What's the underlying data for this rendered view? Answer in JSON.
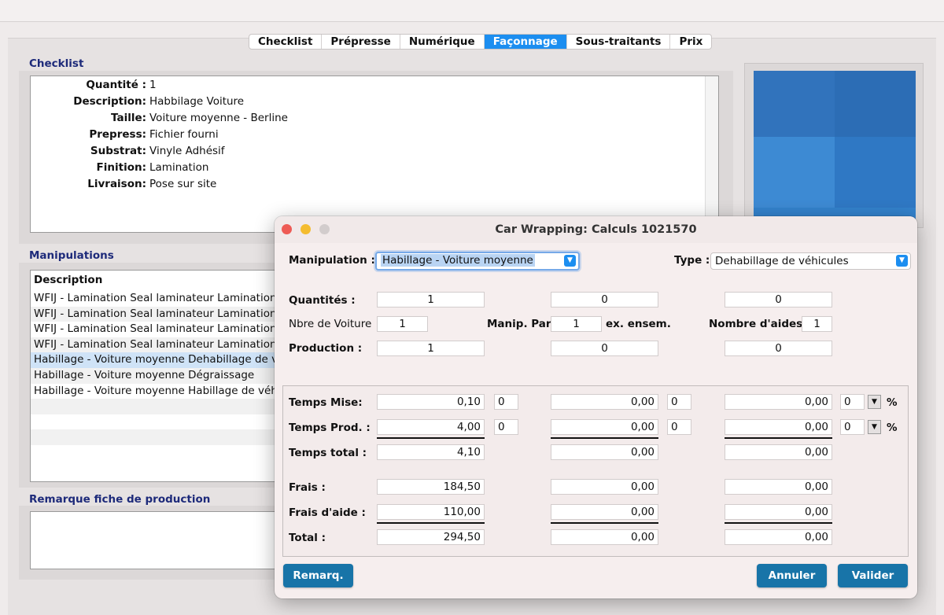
{
  "tabs": [
    {
      "label": "Checklist"
    },
    {
      "label": "Prépresse"
    },
    {
      "label": "Numérique"
    },
    {
      "label": "Façonnage",
      "active": true
    },
    {
      "label": "Sous-traitants"
    },
    {
      "label": "Prix"
    }
  ],
  "checklist": {
    "title": "Checklist",
    "rows": [
      {
        "label": "Quantité :",
        "value": "1"
      },
      {
        "label": "Description:",
        "value": "Habbilage Voiture"
      },
      {
        "label": "Taille:",
        "value": "Voiture moyenne - Berline"
      },
      {
        "label": "Prepress:",
        "value": "Fichier fourni"
      },
      {
        "label": "Substrat:",
        "value": "Vinyle Adhésif"
      },
      {
        "label": "Finition:",
        "value": "Lamination"
      },
      {
        "label": "Livraison:",
        "value": "Pose sur site"
      }
    ]
  },
  "manipulations": {
    "title": "Manipulations",
    "column": "Description",
    "rows": [
      "WFIJ - Lamination Seal laminateur Lamination s",
      "WFIJ - Lamination Seal laminateur Lamination s",
      "WFIJ - Lamination Seal laminateur Lamination s",
      "WFIJ - Lamination Seal laminateur Lamination s",
      "Habillage - Voiture moyenne Dehabillage de vé",
      "Habillage - Voiture moyenne Dégraissage",
      "Habillage - Voiture moyenne Habillage de véhi"
    ],
    "selected_index": 4
  },
  "remarque": {
    "title": "Remarque fiche de production"
  },
  "dialog": {
    "title": "Car Wrapping: Calculs 1021570",
    "manipulation_label": "Manipulation :",
    "manipulation_value": "Habillage - Voiture moyenne",
    "type_label": "Type :",
    "type_value": "Dehabillage de véhicules",
    "quantites_label": "Quantités :",
    "quantites": [
      "1",
      "0",
      "0"
    ],
    "nbre_voiture_label": "Nbre de Voiture",
    "nbre_voiture": "1",
    "manip_par_label": "Manip. Par :",
    "manip_par": "1",
    "ex_ensem_label": "ex. ensem.",
    "nombre_aides_label": "Nombre d'aides :",
    "nombre_aides": "1",
    "production_label": "Production :",
    "production": [
      "1",
      "0",
      "0"
    ],
    "temps_mise_label": "Temps Mise:",
    "temps_mise": [
      "0,10",
      "0,00",
      "0,00"
    ],
    "temps_mise_small": [
      "0",
      "0",
      "0"
    ],
    "temps_prod_label": "Temps Prod. :",
    "temps_prod": [
      "4,00",
      "0,00",
      "0,00"
    ],
    "temps_prod_small": [
      "0",
      "0",
      "0"
    ],
    "temps_total_label": "Temps total :",
    "temps_total": [
      "4,10",
      "0,00",
      "0,00"
    ],
    "frais_label": "Frais :",
    "frais": [
      "184,50",
      "0,00",
      "0,00"
    ],
    "frais_aide_label": "Frais d'aide :",
    "frais_aide": [
      "110,00",
      "0,00",
      "0,00"
    ],
    "total_label": "Total :",
    "total": [
      "294,50",
      "0,00",
      "0,00"
    ],
    "percent": "%",
    "remarq_button": "Remarq.",
    "annuler_button": "Annuler",
    "valider_button": "Valider"
  },
  "colors": {
    "accent": "#1c8ef0",
    "section_title": "#1d2a7a",
    "dialog_button": "#1874a8",
    "selected_row": "#cfe3f7"
  }
}
